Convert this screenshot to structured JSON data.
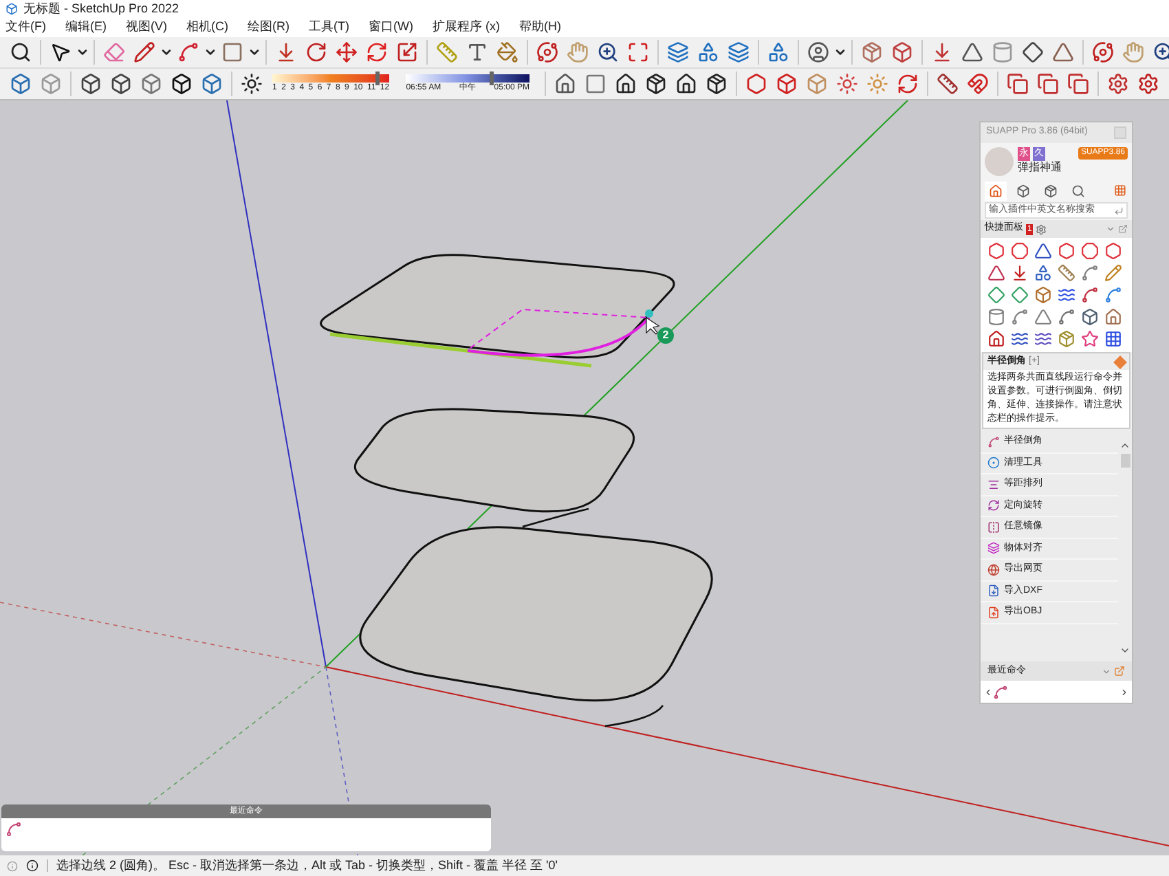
{
  "window": {
    "title": "无标题 - SketchUp Pro 2022"
  },
  "menu": [
    "文件(F)",
    "编辑(E)",
    "视图(V)",
    "相机(C)",
    "绘图(R)",
    "工具(T)",
    "窗口(W)",
    "扩展程序 (x)",
    "帮助(H)"
  ],
  "shadow_slider": {
    "months": [
      "1",
      "2",
      "3",
      "4",
      "5",
      "6",
      "7",
      "8",
      "9",
      "10",
      "11",
      "12"
    ],
    "level": 0.88
  },
  "time_slider": {
    "labels": [
      "06:55 AM",
      "中午",
      "05:00 PM"
    ],
    "level": 0.68
  },
  "canvas": {
    "badge": "2"
  },
  "suapp": {
    "title": "SUAPP Pro 3.86 (64bit)",
    "tags": [
      "永",
      "久"
    ],
    "user": "弹指神通",
    "version_badge": "SUAPP3.86",
    "search": {
      "placeholder": "输入插件中英文名称搜索"
    },
    "panel": {
      "label": "快捷面板",
      "count": "1"
    },
    "tooltip": {
      "title": "半径倒角",
      "plus": "[+]",
      "text": "选择两条共面直线段运行命令并设置参数。可进行倒圆角、倒切角、延伸、连接操作。请注意状态栏的操作提示。"
    },
    "items": [
      "半径倒角",
      "清理工具",
      "等距排列",
      "定向旋转",
      "任意镜像",
      "物体对齐",
      "导出网页",
      "导入DXF",
      "导出OBJ"
    ],
    "recent_label": "最近命令"
  },
  "recent_panel": {
    "title": "最近命令"
  },
  "status_bar": {
    "text": "选择边线 2 (圆角)。 Esc - 取消选择第一条边，Alt 或 Tab - 切换类型，Shift - 覆盖 半径 至 '0'"
  }
}
